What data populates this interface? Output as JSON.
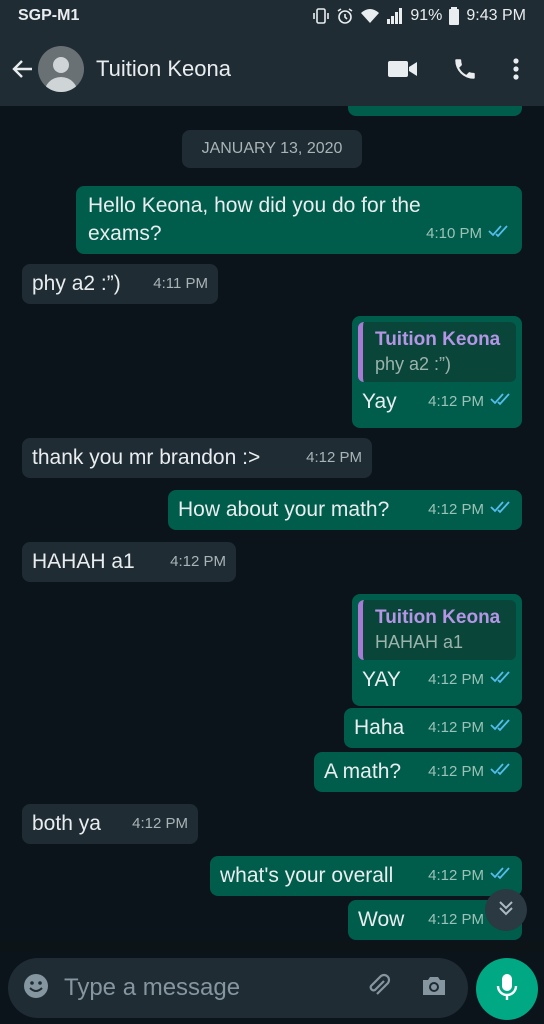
{
  "status": {
    "carrier": "SGP-M1",
    "battery": "91%",
    "time": "9:43 PM"
  },
  "header": {
    "contact_name": "Tuition Keona"
  },
  "chat": {
    "date_chip": "JANUARY 13, 2020",
    "messages": [
      {
        "text_line1": "Hello Keona, how did you do for the",
        "text_line2": "exams?",
        "time": "4:10 PM"
      },
      {
        "text": "phy a2 :”)",
        "time": "4:11 PM"
      },
      {
        "quote_name": "Tuition Keona",
        "quote_text": "phy a2 :”)",
        "text": "Yay",
        "time": "4:12 PM"
      },
      {
        "text": "thank you mr brandon :>",
        "time": "4:12 PM"
      },
      {
        "text": "How about your math?",
        "time": "4:12 PM"
      },
      {
        "text": "HAHAH a1",
        "time": "4:12 PM"
      },
      {
        "quote_name": "Tuition Keona",
        "quote_text": "HAHAH a1",
        "text": "YAY",
        "time": "4:12 PM"
      },
      {
        "text": "Haha",
        "time": "4:12 PM"
      },
      {
        "text": "A math?",
        "time": "4:12 PM"
      },
      {
        "text": "both ya",
        "time": "4:12 PM"
      },
      {
        "text": "what's your overall",
        "time": "4:12 PM"
      },
      {
        "text": "Wow",
        "time": "4:12 PM"
      }
    ]
  },
  "composer": {
    "placeholder": "Type a message"
  },
  "colors": {
    "accent": "#00a884",
    "outgoing_bubble": "#005c4b",
    "incoming_bubble": "#1f2c34",
    "read_ticks": "#53bdeb",
    "quote_name": "#b495e6"
  }
}
